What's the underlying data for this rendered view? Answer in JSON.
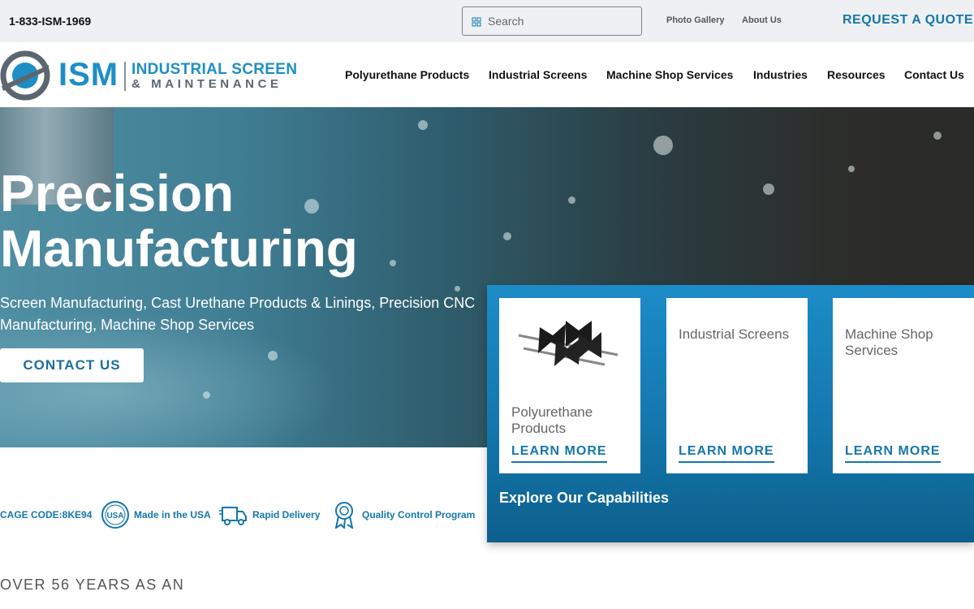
{
  "topbar": {
    "phone": "1-833-ISM-1969",
    "search_placeholder": "Search",
    "links": [
      "Photo Gallery",
      "About Us"
    ],
    "quote": "REQUEST A QUOTE"
  },
  "header": {
    "logo": {
      "mark": "ISM",
      "line1": "INDUSTRIAL SCREEN",
      "line2": "& MAINTENANCE"
    },
    "nav": [
      "Polyurethane Products",
      "Industrial Screens",
      "Machine Shop Services",
      "Industries",
      "Resources",
      "Contact Us"
    ]
  },
  "hero": {
    "title": "Precision Manufacturing",
    "subtitle": "Screen Manufacturing, Cast Urethane Products & Linings, Precision CNC Manufacturing, Machine Shop Services",
    "cta": "CONTACT US"
  },
  "capabilities": {
    "cards": [
      {
        "title": "Polyurethane Products",
        "link": "LEARN MORE"
      },
      {
        "title": "Industrial Screens",
        "link": "LEARN MORE"
      },
      {
        "title": "Machine Shop Services",
        "link": "LEARN MORE"
      }
    ],
    "footer": "Explore Our Capabilities"
  },
  "badges": {
    "cage_code": "CAGE CODE:8KE94",
    "items": [
      {
        "label": "Made in the USA",
        "icon": "usa-seal-icon"
      },
      {
        "label": "Rapid Delivery",
        "icon": "delivery-truck-icon"
      },
      {
        "label": "Quality Control Program",
        "icon": "award-ribbon-icon"
      }
    ]
  },
  "intro": {
    "eyebrow": "OVER 56 YEARS AS AN"
  },
  "colors": {
    "accent": "#1477ad",
    "brand_blue": "#1f8ec4",
    "topbar_bg": "#eef0f3"
  }
}
